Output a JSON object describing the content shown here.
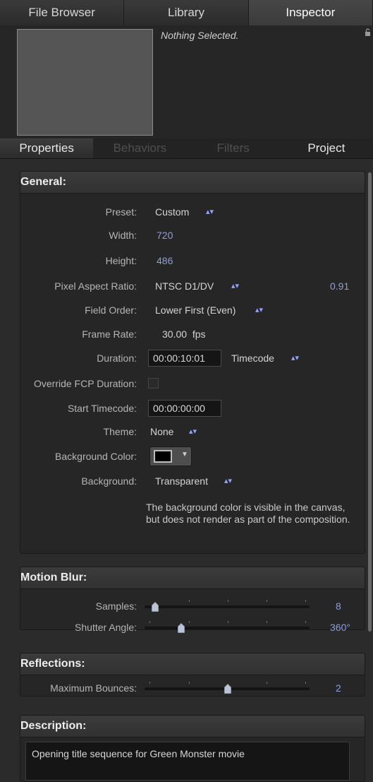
{
  "top_tabs": [
    "File Browser",
    "Library",
    "Inspector"
  ],
  "preview": {
    "nothing_selected": "Nothing Selected."
  },
  "sub_tabs": [
    "Properties",
    "Behaviors",
    "Filters",
    "Project"
  ],
  "general": {
    "title": "General:",
    "preset_label": "Preset:",
    "preset_value": "Custom",
    "width_label": "Width:",
    "width_value": "720",
    "height_label": "Height:",
    "height_value": "486",
    "par_label": "Pixel Aspect Ratio:",
    "par_value": "NTSC D1/DV",
    "par_number": "0.91",
    "field_order_label": "Field Order:",
    "field_order_value": "Lower First (Even)",
    "frame_rate_label": "Frame Rate:",
    "frame_rate_value": "30.00  fps",
    "duration_label": "Duration:",
    "duration_value": "00:00:10:01",
    "duration_format": "Timecode",
    "override_label": "Override FCP Duration:",
    "start_tc_label": "Start Timecode:",
    "start_tc_value": "00:00:00:00",
    "theme_label": "Theme:",
    "theme_value": "None",
    "bg_color_label": "Background Color:",
    "background_label": "Background:",
    "background_value": "Transparent",
    "note": "The background color is visible in the canvas, but does not render as part of the composition."
  },
  "motion_blur": {
    "title": "Motion Blur:",
    "samples_label": "Samples:",
    "samples_value": "8",
    "shutter_label": "Shutter Angle:",
    "shutter_value": "360°"
  },
  "reflections": {
    "title": "Reflections:",
    "bounces_label": "Maximum Bounces:",
    "bounces_value": "2"
  },
  "description": {
    "title": "Description:",
    "text": "Opening title sequence for Green Monster movie"
  }
}
